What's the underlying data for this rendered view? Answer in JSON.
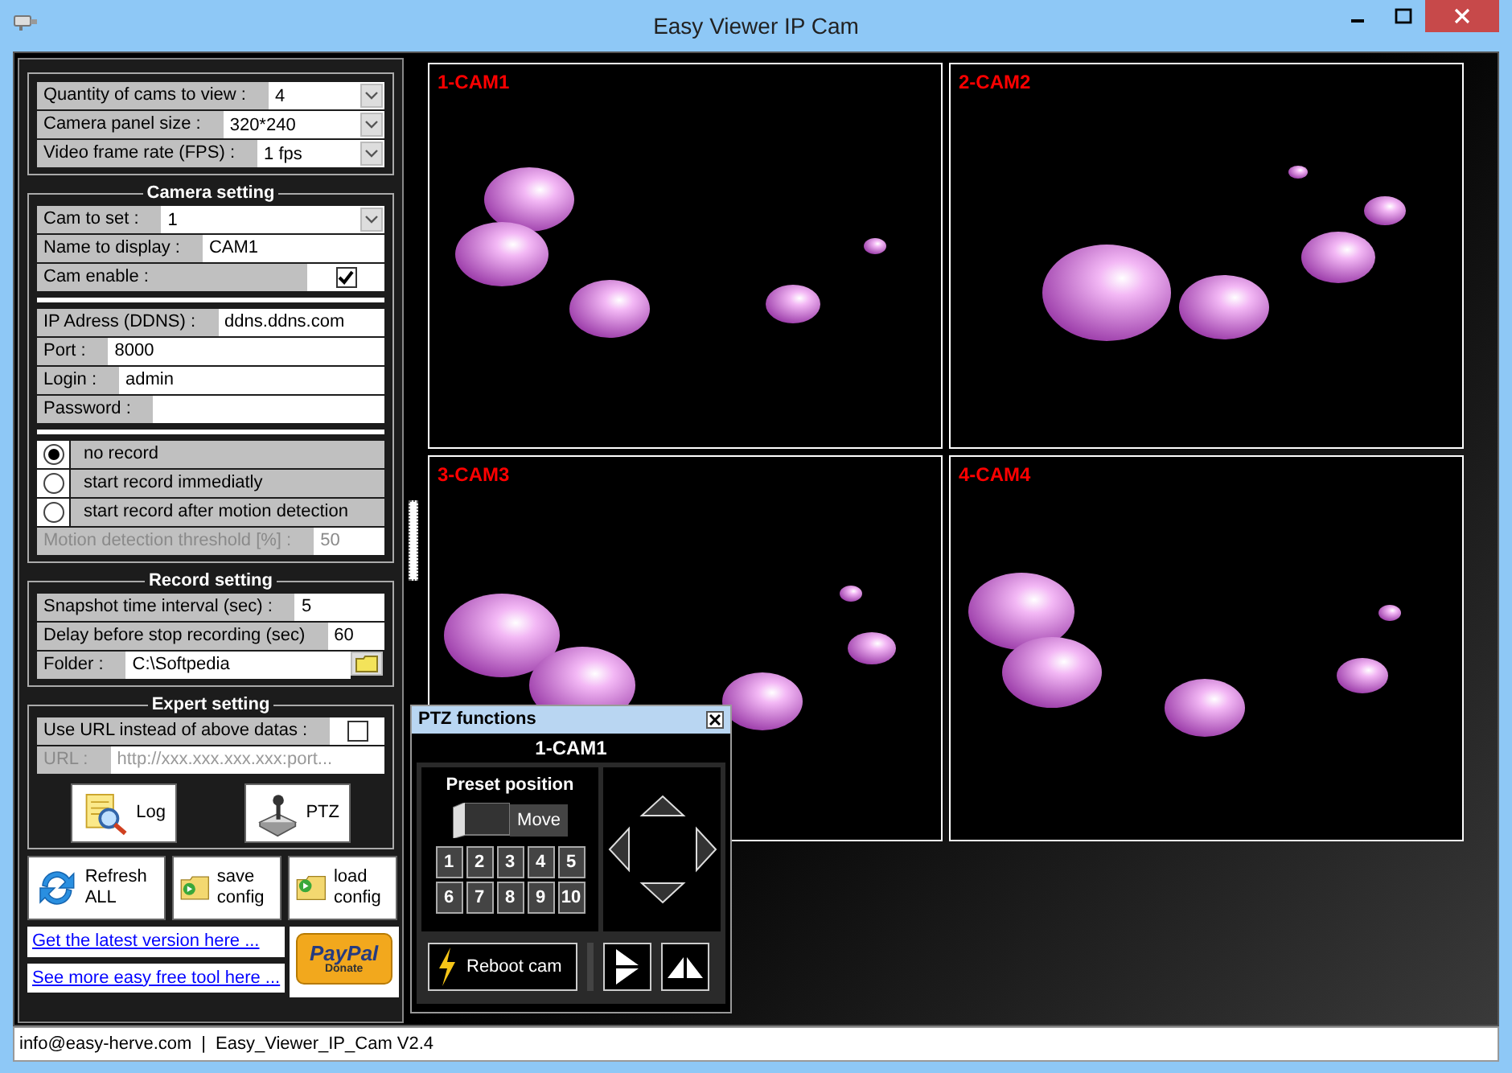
{
  "window": {
    "title": "Easy Viewer IP Cam"
  },
  "view_settings": [
    {
      "kind": "select",
      "label": "Quantity of cams to view :",
      "value": "4"
    },
    {
      "kind": "select",
      "label": "Camera panel size :",
      "value": "320*240"
    },
    {
      "kind": "select",
      "label": "Video frame rate (FPS) :",
      "value": "1 fps"
    }
  ],
  "camera_setting": {
    "title": "Camera setting",
    "groups": [
      [
        {
          "kind": "select",
          "label": "Cam to set :",
          "value": "1"
        },
        {
          "kind": "text",
          "label": "Name to display :",
          "value": "CAM1"
        },
        {
          "kind": "checkbox",
          "label": "Cam enable :",
          "checked": true
        }
      ],
      [
        {
          "kind": "text",
          "label": "IP Adress (DDNS) :",
          "value": "ddns.ddns.com"
        },
        {
          "kind": "text",
          "label": "Port :",
          "value": "8000"
        },
        {
          "kind": "text",
          "label": "Login :",
          "value": "admin"
        },
        {
          "kind": "text",
          "label": "Password :"
        }
      ],
      [
        {
          "kind": "radio",
          "label": "no record",
          "selected": true
        },
        {
          "kind": "radio",
          "label": "start record immediatly",
          "selected": false
        },
        {
          "kind": "radio",
          "label": "start record after motion detection",
          "selected": false
        },
        {
          "kind": "text",
          "label": "Motion detection threshold [%] :",
          "value": "50",
          "disabled": true
        }
      ]
    ]
  },
  "record_setting": {
    "title": "Record setting",
    "fields": [
      {
        "kind": "text",
        "label": "Snapshot time interval (sec) :",
        "value": "5"
      },
      {
        "kind": "text",
        "label": "Delay before stop recording (sec)",
        "value": "60"
      },
      {
        "kind": "folder",
        "label": "Folder :",
        "value": "C:\\Softpedia"
      }
    ]
  },
  "expert_setting": {
    "title": "Expert setting",
    "fields": [
      {
        "kind": "checkbox",
        "label": "Use URL instead of above datas :",
        "checked": false
      },
      {
        "kind": "text",
        "label": "URL :",
        "placeholder": "http://xxx.xxx.xxx.xxx:port...",
        "disabled": true
      }
    ],
    "buttons": [
      {
        "kind": "log",
        "label": "Log"
      },
      {
        "kind": "ptz",
        "label": "PTZ"
      }
    ]
  },
  "action_buttons": [
    {
      "kind": "refresh",
      "label": "Refresh ALL"
    },
    {
      "kind": "save",
      "label": "save config"
    },
    {
      "kind": "load",
      "label": "load config"
    }
  ],
  "links": [
    "Get the latest version here ...",
    "See more easy free tool here ..."
  ],
  "donate_button": {
    "brand": "PayPal",
    "caption": "Donate"
  },
  "cameras": [
    {
      "label": "1-CAM1"
    },
    {
      "label": "2-CAM2"
    },
    {
      "label": "3-CAM3"
    },
    {
      "label": "4-CAM4"
    }
  ],
  "ptz_window": {
    "title": "PTZ functions",
    "camera": "1-CAM1",
    "preset_title": "Preset position",
    "move_button": "Move",
    "presets": [
      "1",
      "2",
      "3",
      "4",
      "5",
      "6",
      "7",
      "8",
      "9",
      "10"
    ],
    "reboot_button": "Reboot cam"
  },
  "status_bar": [
    "info@easy-herve.com",
    "|",
    "Easy_Viewer_IP_Cam V2.4"
  ]
}
